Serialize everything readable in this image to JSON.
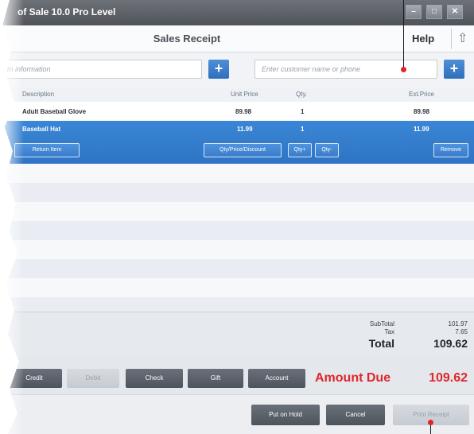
{
  "window": {
    "title": "of Sale 10.0 Pro Level",
    "minimize_glyph": "–",
    "maximize_glyph": "□",
    "close_glyph": "✕"
  },
  "header": {
    "title": "Sales Receipt",
    "help_label": "Help",
    "up_icon": "up-arrow-icon",
    "up_glyph": "⇧"
  },
  "search": {
    "item_placeholder": "m information",
    "customer_placeholder": "Enter customer name or phone",
    "add_glyph": "+"
  },
  "table": {
    "columns": {
      "description": "Description",
      "unit_price": "Unit Price",
      "qty": "Qty.",
      "ext_price": "Ext.Price"
    },
    "rows": [
      {
        "description": "Adult Baseball Glove",
        "unit_price": "89.98",
        "qty": "1",
        "ext_price": "89.98",
        "selected": false
      },
      {
        "description": "Baseball Hat",
        "unit_price": "11.99",
        "qty": "1",
        "ext_price": "11.99",
        "selected": true
      }
    ],
    "row_actions": {
      "return_item": "Return Item",
      "qty_price_discount": "Qty/Price/Discount",
      "qty_plus": "Qty+",
      "qty_minus": "Qty-",
      "remove": "Remove"
    }
  },
  "totals": {
    "subtotal_label": "SubTotal",
    "subtotal_value": "101.97",
    "tax_label": "Tax",
    "tax_value": "7.65",
    "total_label": "Total",
    "total_value": "109.62"
  },
  "payment": {
    "credit": "Credit",
    "debit": "Debit",
    "check": "Check",
    "gift": "Gift",
    "account": "Account",
    "amount_due_label": "Amount Due",
    "amount_due_value": "109.62"
  },
  "actions": {
    "put_on_hold": "Put on Hold",
    "cancel": "Cancel",
    "print_receipt": "Print Receipt"
  },
  "colors": {
    "accent_blue": "#2f74c4",
    "amount_due_red": "#e0262b",
    "dark_button": "#555b63",
    "disabled_button": "#c9ced5"
  }
}
